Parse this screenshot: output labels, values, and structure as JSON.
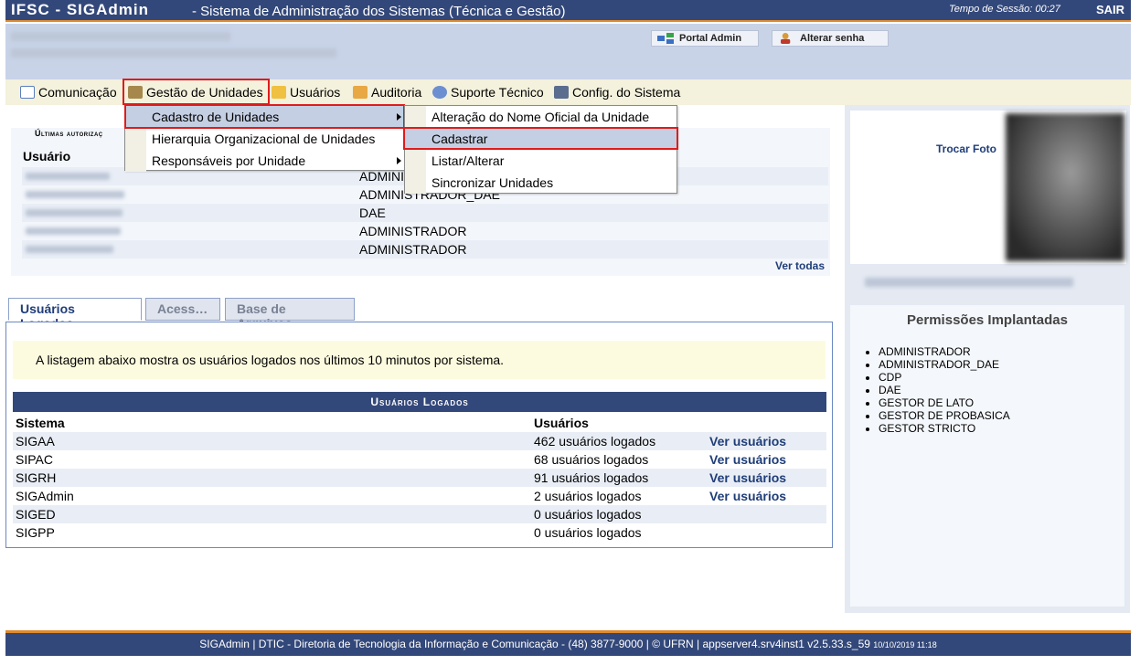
{
  "topbar": {
    "brand": "IFSC - SIGAdmin",
    "system_name": "- Sistema de Administração dos Sistemas (Técnica e Gestão)",
    "session_label": "Tempo de Sessão: 00:27",
    "logout": "SAIR"
  },
  "userbar": {
    "portal_admin": "Portal Admin",
    "change_password": "Alterar senha"
  },
  "menu": {
    "items": [
      "Comunicação",
      "Gestão de Unidades",
      "Usuários",
      "Auditoria",
      "Suporte Técnico",
      "Config. do Sistema"
    ],
    "submenu": [
      "Cadastro de Unidades",
      "Hierarquia Organizacional de Unidades",
      "Responsáveis por Unidade"
    ],
    "subsubmenu": [
      "Alteração do Nome Oficial da Unidade",
      "Cadastrar",
      "Listar/Alterar",
      "Sincronizar Unidades"
    ]
  },
  "auth": {
    "title": "Últimas autorizaç",
    "col_user": "Usuário",
    "roles": [
      "ADMINI",
      "ADMINISTRADOR_DAE",
      "DAE",
      "ADMINISTRADOR",
      "ADMINISTRADOR"
    ],
    "see_all": "Ver todas"
  },
  "tabs": [
    "Usuários Logados",
    "Acess…",
    "Base de Arquivos"
  ],
  "logged": {
    "note": "A listagem abaixo mostra os usuários logados nos últimos 10 minutos por sistema.",
    "table_title": "Usuários Logados",
    "col_system": "Sistema",
    "col_users": "Usuários",
    "rows": [
      {
        "system": "SIGAA",
        "users": "462 usuários logados",
        "link": "Ver usuários"
      },
      {
        "system": "SIPAC",
        "users": "68 usuários logados",
        "link": "Ver usuários"
      },
      {
        "system": "SIGRH",
        "users": "91 usuários logados",
        "link": "Ver usuários"
      },
      {
        "system": "SIGAdmin",
        "users": "2 usuários logados",
        "link": "Ver usuários"
      },
      {
        "system": "SIGED",
        "users": "0 usuários logados",
        "link": ""
      },
      {
        "system": "SIGPP",
        "users": "0 usuários logados",
        "link": ""
      }
    ]
  },
  "profile": {
    "change_photo": "Trocar Foto",
    "permissions_title": "Permissões Implantadas",
    "permissions": [
      "ADMINISTRADOR",
      "ADMINISTRADOR_DAE",
      "CDP",
      "DAE",
      "GESTOR DE LATO",
      "GESTOR DE PROBASICA",
      "GESTOR STRICTO"
    ]
  },
  "footer": {
    "text": "SIGAdmin | DTIC - Diretoria de Tecnologia da Informação e Comunicação - (48) 3877-9000 | © UFRN | appserver4.srv4inst1 v2.5.33.s_59",
    "timestamp": "10/10/2019 11:18"
  },
  "colors": {
    "header": "#33487a",
    "accent": "#e08a2e",
    "highlight": "#e01b1b"
  }
}
